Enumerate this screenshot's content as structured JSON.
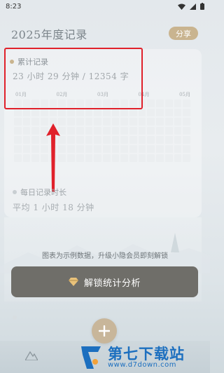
{
  "status_bar": {
    "time": "8:23"
  },
  "header": {
    "title": "2025年度记录",
    "share_label": "分享"
  },
  "stats": {
    "cumulative_title": "累计记录",
    "cumulative_value": "23 小时 29 分钟 / 12354 字",
    "months": [
      "01月",
      "02月",
      "03月",
      "04月",
      "05月"
    ],
    "daily_title": "每日记录时长",
    "daily_value": "平均 1 小时 18 分钟"
  },
  "overlay": {
    "demo_note": "图表为示例数据，升级小隐会员即刻解锁",
    "unlock_label": "解锁统计分析"
  },
  "watermark": {
    "title": "第七下载站",
    "url": "www.d7down.com"
  },
  "colors": {
    "accent": "#c9b48f",
    "unlock_button": "#6f6e69",
    "highlight": "#e0212b",
    "watermark": "#1c6fbf"
  }
}
